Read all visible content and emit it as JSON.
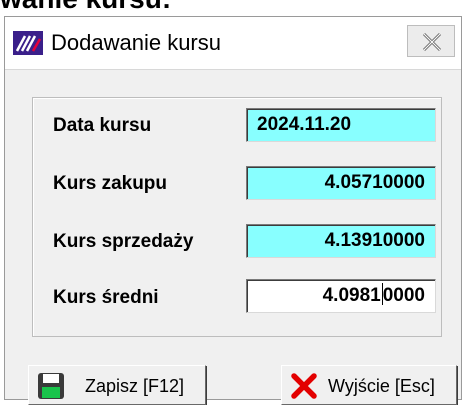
{
  "header_fragment": "wanie kursu:",
  "window": {
    "title": "Dodawanie kursu",
    "app_icon": "app-logo-icon",
    "close_icon": "close-icon"
  },
  "form": {
    "fields": [
      {
        "label": "Data kursu",
        "value": "2024.11.20",
        "align": "left",
        "bg": "#88ffff"
      },
      {
        "label": "Kurs zakupu",
        "value": "4.05710000",
        "align": "right",
        "bg": "#88ffff"
      },
      {
        "label": "Kurs sprzedaży",
        "value": "4.13910000",
        "align": "right",
        "bg": "#88ffff"
      },
      {
        "label": "Kurs średni",
        "value_before_caret": "4.0981",
        "value_after_caret": "0000",
        "align": "right",
        "bg": "#ffffff",
        "focused": true
      }
    ]
  },
  "buttons": {
    "save": {
      "label": "Zapisz  [F12]",
      "icon": "floppy-disk-icon"
    },
    "exit": {
      "label": "Wyjście  [Esc]",
      "icon": "red-x-icon"
    }
  }
}
